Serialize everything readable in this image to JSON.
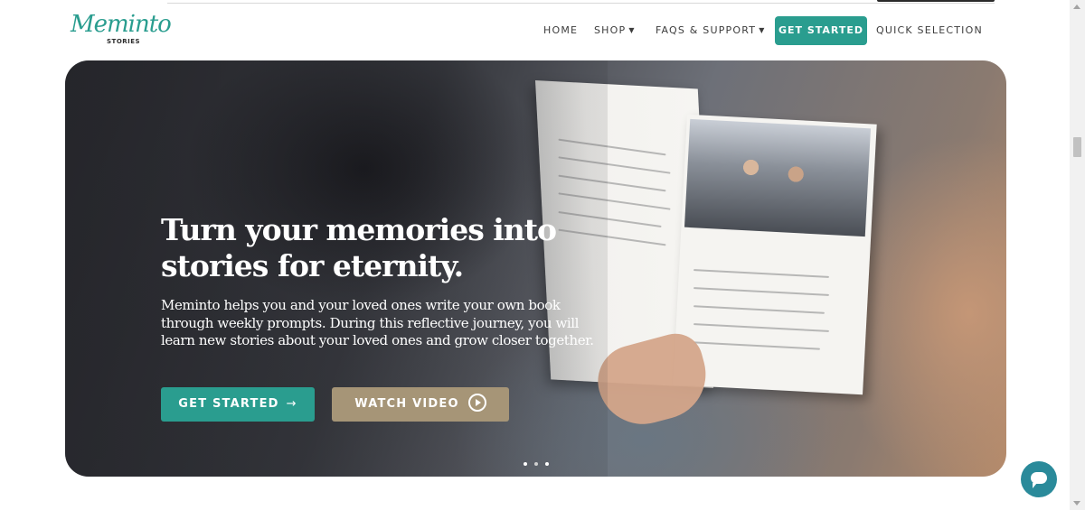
{
  "logo": {
    "script": "Meminto",
    "sub": "STORIES"
  },
  "nav": {
    "items": [
      {
        "label": "HOME"
      },
      {
        "label": "SHOP"
      },
      {
        "label": "FAQS & SUPPORT"
      },
      {
        "label": "QUICK SELECTION"
      }
    ],
    "cta": "GET STARTED"
  },
  "hero": {
    "title": "Turn your memories into stories for eternity.",
    "description": "Meminto helps you and your loved ones write your own book through weekly prompts. During this reflective journey, you will learn new stories about your loved ones and grow closer together.",
    "primary_button": "GET STARTED",
    "secondary_button": "WATCH VIDEO",
    "slides": 3
  },
  "colors": {
    "accent": "#2a9d8f",
    "gold": "#a69577",
    "chat": "#2a8a9a"
  },
  "icons": {
    "primary_arrow": "arrow-right-icon",
    "secondary": "play-circle-icon",
    "dropdown": "chevron-down-icon",
    "chat": "chat-bubble-icon"
  }
}
